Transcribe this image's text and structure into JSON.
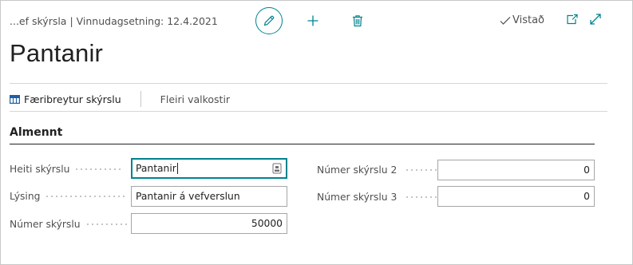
{
  "header": {
    "breadcrumb": "...ef skýrsla | Vinnudagsetning: 12.4.2021",
    "saved_label": "Vistað"
  },
  "page": {
    "title": "Pantanir"
  },
  "actions": {
    "report_settings": "Færibreytur skýrslu",
    "more_options": "Fleiri valkostir"
  },
  "section": {
    "title": "Almennt",
    "fields_left": [
      {
        "label": "Heiti skýrslu",
        "value": "Pantanir"
      },
      {
        "label": "Lýsing",
        "value": "Pantanir á vefverslun"
      },
      {
        "label": "Númer skýrslu",
        "value": "50000"
      }
    ],
    "fields_right": [
      {
        "label": "Númer skýrslu 2",
        "value": "0"
      },
      {
        "label": "Númer skýrslu 3",
        "value": "0"
      }
    ]
  },
  "colors": {
    "accent": "#00838f",
    "text": "#212121",
    "muted": "#505050",
    "border": "#a6a6a6"
  },
  "icons": [
    "edit-pencil-icon",
    "plus-icon",
    "trash-icon",
    "checkmark-icon",
    "open-new-window-icon",
    "expand-icon",
    "table-icon",
    "assist-edit-icon"
  ]
}
